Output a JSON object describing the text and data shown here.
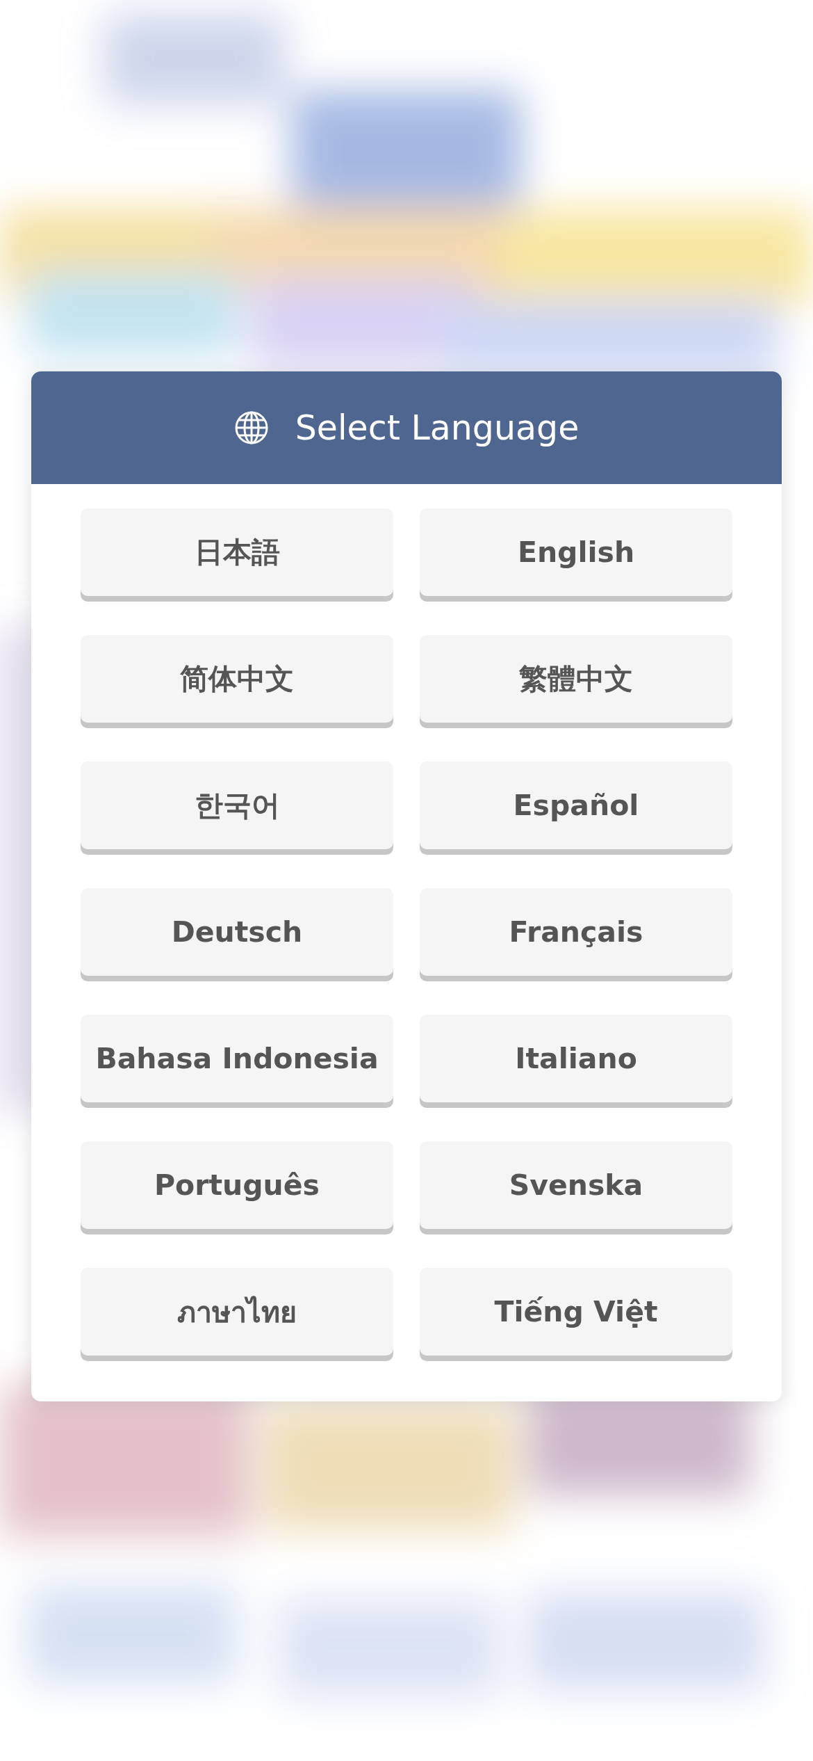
{
  "dialog": {
    "title": "Select Language",
    "languages": [
      {
        "label": "日本語"
      },
      {
        "label": "English"
      },
      {
        "label": "简体中文"
      },
      {
        "label": "繁體中文"
      },
      {
        "label": "한국어"
      },
      {
        "label": "Español"
      },
      {
        "label": "Deutsch"
      },
      {
        "label": "Français"
      },
      {
        "label": "Bahasa Indonesia"
      },
      {
        "label": "Italiano"
      },
      {
        "label": "Português"
      },
      {
        "label": "Svenska"
      },
      {
        "label": "ภาษาไทย"
      },
      {
        "label": "Tiếng Việt"
      }
    ]
  }
}
